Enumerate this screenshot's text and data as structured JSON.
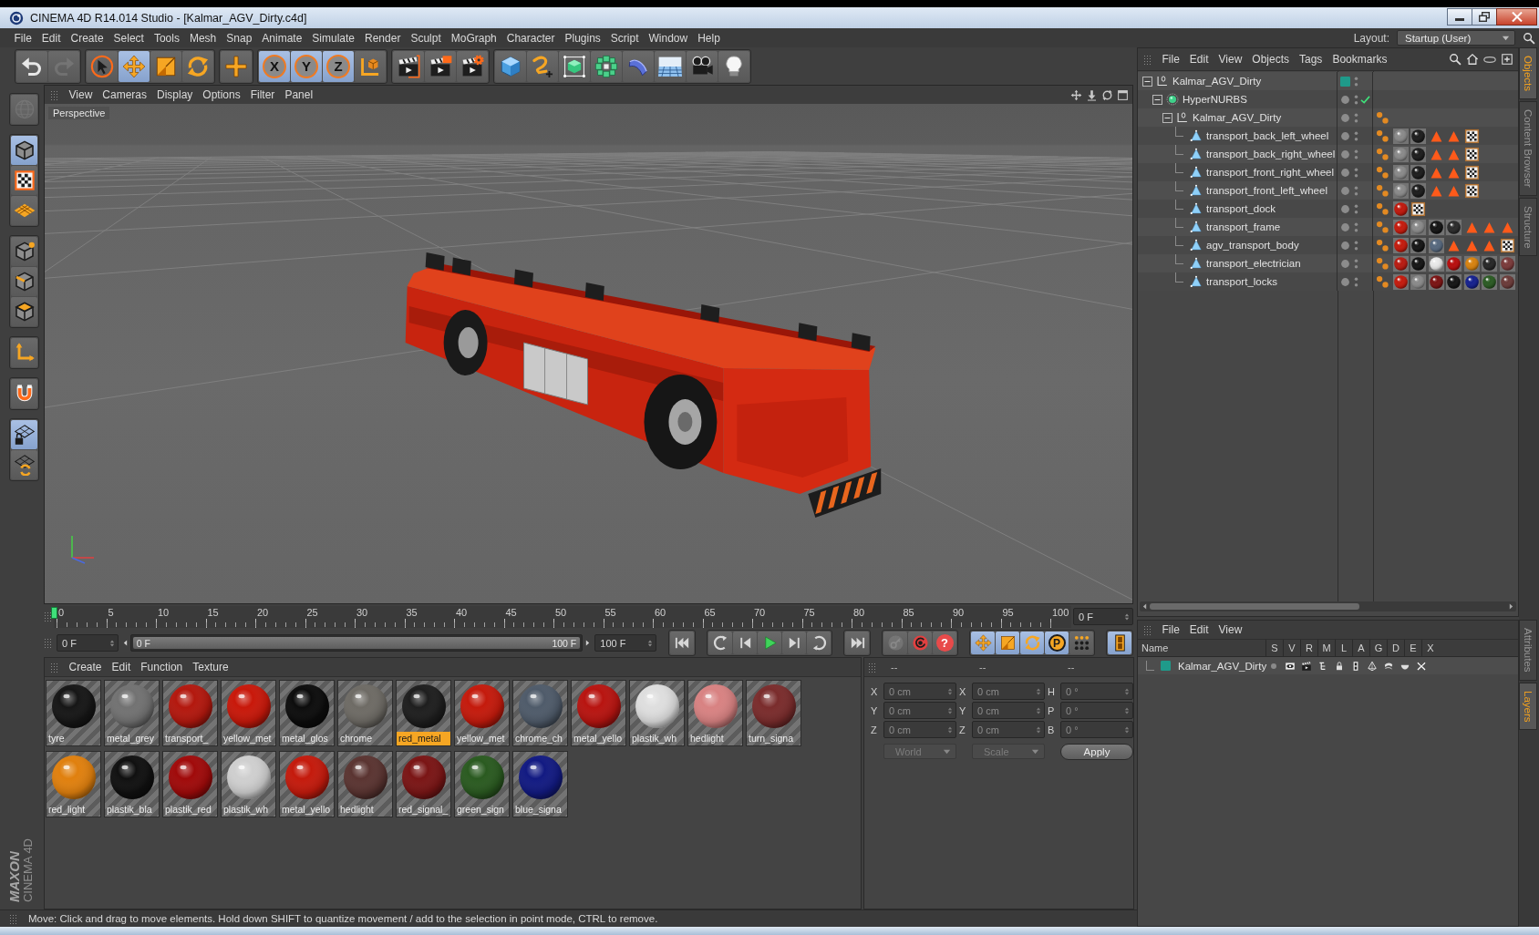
{
  "window": {
    "title": "CINEMA 4D R14.014 Studio - [Kalmar_AGV_Dirty.c4d]"
  },
  "menu_bar": {
    "items": [
      "File",
      "Edit",
      "Create",
      "Select",
      "Tools",
      "Mesh",
      "Snap",
      "Animate",
      "Simulate",
      "Render",
      "Sculpt",
      "MoGraph",
      "Character",
      "Plugins",
      "Script",
      "Window",
      "Help"
    ],
    "layout_label": "Layout:",
    "layout_value": "Startup (User)"
  },
  "toolbar": [
    [
      {
        "kind": "undo",
        "selected": false,
        "disabled": false
      },
      {
        "kind": "redo",
        "selected": false,
        "disabled": true
      }
    ],
    [
      {
        "kind": "select",
        "selected": false,
        "disabled": false
      },
      {
        "kind": "move",
        "selected": true,
        "disabled": false
      },
      {
        "kind": "scale",
        "selected": false,
        "disabled": false
      },
      {
        "kind": "rotate",
        "selected": false,
        "disabled": false
      }
    ],
    [
      {
        "kind": "recent",
        "selected": false,
        "disabled": false
      }
    ],
    [
      {
        "kind": "axislock",
        "label": "X",
        "selected": true,
        "disabled": false
      },
      {
        "kind": "axislock",
        "label": "Y",
        "selected": true,
        "disabled": false
      },
      {
        "kind": "axislock",
        "label": "Z",
        "selected": true,
        "disabled": false
      },
      {
        "kind": "coords",
        "selected": false,
        "disabled": false
      }
    ],
    [
      {
        "kind": "renderview",
        "selected": false,
        "disabled": false
      },
      {
        "kind": "renderpv",
        "selected": false,
        "disabled": false
      },
      {
        "kind": "rendersettings",
        "selected": false,
        "disabled": false
      }
    ],
    [
      {
        "kind": "cube",
        "selected": false,
        "disabled": false
      },
      {
        "kind": "spline",
        "selected": false,
        "disabled": false
      },
      {
        "kind": "subdiv",
        "selected": false,
        "disabled": false
      },
      {
        "kind": "array",
        "selected": false,
        "disabled": false
      },
      {
        "kind": "deformer",
        "selected": false,
        "disabled": false
      },
      {
        "kind": "floor",
        "selected": false,
        "disabled": false
      },
      {
        "kind": "camera",
        "selected": false,
        "disabled": false
      },
      {
        "kind": "light",
        "selected": false,
        "disabled": false
      }
    ]
  ],
  "mode_toolbar": [
    [
      {
        "kind": "editable",
        "selected": false,
        "disabled": true
      }
    ],
    [
      {
        "kind": "model",
        "selected": true,
        "disabled": false
      },
      {
        "kind": "texture",
        "selected": false,
        "disabled": false
      },
      {
        "kind": "workplane",
        "selected": false,
        "disabled": false
      }
    ],
    [
      {
        "kind": "points",
        "selected": false,
        "disabled": false
      },
      {
        "kind": "edges",
        "selected": false,
        "disabled": false
      },
      {
        "kind": "polygons",
        "selected": false,
        "disabled": false
      }
    ],
    [
      {
        "kind": "axismode",
        "selected": false,
        "disabled": false
      }
    ],
    [
      {
        "kind": "magnet",
        "selected": false,
        "disabled": false
      }
    ],
    [
      {
        "kind": "lockplane",
        "selected": true,
        "disabled": false
      },
      {
        "kind": "planecycle",
        "selected": false,
        "disabled": false
      }
    ]
  ],
  "viewport": {
    "menu": [
      "View",
      "Cameras",
      "Display",
      "Options",
      "Filter",
      "Panel"
    ],
    "camera": "Perspective"
  },
  "timeline": {
    "ticks": [
      "0",
      "5",
      "10",
      "15",
      "20",
      "25",
      "30",
      "35",
      "40",
      "45",
      "50",
      "55",
      "60",
      "65",
      "70",
      "75",
      "80",
      "85",
      "90",
      "95",
      "100"
    ],
    "playhead": {
      "level": 0
    },
    "current_frame": "0 F"
  },
  "playback": {
    "start_field": "0 F",
    "range": {
      "start": "0 F",
      "end": "100 F",
      "level": 1
    },
    "end_field": "100 F",
    "buttons": [
      [
        {
          "kind": "start",
          "selected": false,
          "disabled": false
        }
      ],
      [
        {
          "kind": "prevkey",
          "selected": false,
          "disabled": false
        },
        {
          "kind": "prevframe",
          "selected": false,
          "disabled": false
        },
        {
          "kind": "play",
          "selected": false,
          "disabled": false
        },
        {
          "kind": "nextframe",
          "selected": false,
          "disabled": false
        },
        {
          "kind": "nextkey",
          "selected": false,
          "disabled": false
        }
      ],
      [
        {
          "kind": "end",
          "selected": false,
          "disabled": false
        }
      ],
      [
        {
          "kind": "key",
          "selected": false,
          "disabled": true
        },
        {
          "kind": "autokey",
          "selected": false,
          "disabled": false
        },
        {
          "kind": "keysel",
          "label": "?",
          "selected": false,
          "disabled": false
        }
      ],
      [
        {
          "kind": "pos",
          "selected": true,
          "disabled": false
        },
        {
          "kind": "scl",
          "selected": true,
          "disabled": false
        },
        {
          "kind": "rot",
          "selected": true,
          "disabled": false
        },
        {
          "kind": "param",
          "label": "P",
          "selected": true,
          "disabled": false
        },
        {
          "kind": "pla",
          "selected": false,
          "disabled": false
        }
      ],
      [
        {
          "kind": "timeline",
          "selected": true,
          "disabled": false
        }
      ]
    ]
  },
  "material_manager": {
    "menu": [
      "Create",
      "Edit",
      "Function",
      "Texture"
    ],
    "materials": [
      {
        "name": "tyre",
        "color": "#161616",
        "selected": false
      },
      {
        "name": "metal_grey",
        "color": "#727272",
        "selected": false
      },
      {
        "name": "transport_",
        "color": "#b3180e",
        "selected": false
      },
      {
        "name": "yellow_met",
        "color": "#c8180a",
        "selected": false
      },
      {
        "name": "metal_glos",
        "color": "#0c0c0c",
        "selected": false
      },
      {
        "name": "chrome",
        "color": "#6e6b65",
        "selected": false
      },
      {
        "name": "red_metal",
        "color": "#1e1e1e",
        "selected": true
      },
      {
        "name": "yellow_met",
        "color": "#c41a0c",
        "selected": false
      },
      {
        "name": "chrome_ch",
        "color": "#4f5b6a",
        "selected": false
      },
      {
        "name": "metal_yello",
        "color": "#b81410",
        "selected": false
      },
      {
        "name": "plastik_wh",
        "color": "#dedede",
        "selected": false
      },
      {
        "name": "hedlight",
        "color": "#d88282",
        "selected": false
      },
      {
        "name": "turn_signa",
        "color": "#7a2c2c",
        "selected": false
      },
      {
        "name": "red_light",
        "color": "#e0800e",
        "selected": false
      },
      {
        "name": "plastik_bla",
        "color": "#101010",
        "selected": false
      },
      {
        "name": "plastik_red",
        "color": "#a00a0a",
        "selected": false
      },
      {
        "name": "plastik_wh",
        "color": "#cfcfcf",
        "selected": false
      },
      {
        "name": "metal_yello",
        "color": "#c41a0c",
        "selected": false
      },
      {
        "name": "hedlight",
        "color": "#5a3431",
        "selected": false
      },
      {
        "name": "red_signal_",
        "color": "#7a1515",
        "selected": false
      },
      {
        "name": "green_sign",
        "color": "#2a5a20",
        "selected": false
      },
      {
        "name": "blue_signa",
        "color": "#121a82",
        "selected": false
      }
    ]
  },
  "coordinates": {
    "headers": [
      "--",
      "--",
      "--"
    ],
    "rows": [
      [
        {
          "axis": "X",
          "value": "0 cm"
        },
        {
          "axis": "X",
          "value": "0 cm"
        },
        {
          "axis": "H",
          "value": "0 °"
        }
      ],
      [
        {
          "axis": "Y",
          "value": "0 cm"
        },
        {
          "axis": "Y",
          "value": "0 cm"
        },
        {
          "axis": "P",
          "value": "0 °"
        }
      ],
      [
        {
          "axis": "Z",
          "value": "0 cm"
        },
        {
          "axis": "Z",
          "value": "0 cm"
        },
        {
          "axis": "B",
          "value": "0 °"
        }
      ]
    ],
    "dropdowns": [
      {
        "value": "World",
        "disabled": true
      },
      {
        "value": "Scale",
        "disabled": true
      }
    ],
    "apply": "Apply"
  },
  "object_manager": {
    "menu": [
      "File",
      "Edit",
      "View",
      "Objects",
      "Tags",
      "Bookmarks"
    ],
    "objects": [
      {
        "name": "Kalmar_AGV_Dirty",
        "kind": "null",
        "color": "#1f9a8a",
        "expanded": true,
        "selected": false,
        "children": [
          {
            "name": "HyperNURBS",
            "kind": "subdiv",
            "enabled": true,
            "expanded": true,
            "selected": false,
            "children": [
              {
                "name": "Kalmar_AGV_Dirty",
                "kind": "null",
                "expanded": true,
                "selected": false,
                "tags": [
                  {
                    "kind": "phong"
                  }
                ],
                "children": [
                  {
                    "name": "transport_back_left_wheel",
                    "kind": "polygon",
                    "selected": false,
                    "tags": [
                      {
                        "kind": "phong"
                      },
                      {
                        "kind": "material",
                        "color": "#8a8a8a"
                      },
                      {
                        "kind": "material",
                        "color": "#1c1c1c"
                      },
                      {
                        "kind": "selection"
                      },
                      {
                        "kind": "selection"
                      },
                      {
                        "kind": "uvw"
                      }
                    ]
                  },
                  {
                    "name": "transport_back_right_wheel",
                    "kind": "polygon",
                    "selected": false,
                    "tags": [
                      {
                        "kind": "phong"
                      },
                      {
                        "kind": "material",
                        "color": "#8a8a8a"
                      },
                      {
                        "kind": "material",
                        "color": "#1c1c1c"
                      },
                      {
                        "kind": "selection"
                      },
                      {
                        "kind": "selection"
                      },
                      {
                        "kind": "uvw"
                      }
                    ]
                  },
                  {
                    "name": "transport_front_right_wheel",
                    "kind": "polygon",
                    "selected": false,
                    "tags": [
                      {
                        "kind": "phong"
                      },
                      {
                        "kind": "material",
                        "color": "#8a8a8a"
                      },
                      {
                        "kind": "material",
                        "color": "#1c1c1c"
                      },
                      {
                        "kind": "selection"
                      },
                      {
                        "kind": "selection"
                      },
                      {
                        "kind": "uvw"
                      }
                    ]
                  },
                  {
                    "name": "transport_front_left_wheel",
                    "kind": "polygon",
                    "selected": false,
                    "tags": [
                      {
                        "kind": "phong"
                      },
                      {
                        "kind": "material",
                        "color": "#8a8a8a"
                      },
                      {
                        "kind": "material",
                        "color": "#1c1c1c"
                      },
                      {
                        "kind": "selection"
                      },
                      {
                        "kind": "selection"
                      },
                      {
                        "kind": "uvw"
                      }
                    ]
                  },
                  {
                    "name": "transport_dock",
                    "kind": "polygon",
                    "selected": false,
                    "tags": [
                      {
                        "kind": "phong"
                      },
                      {
                        "kind": "material",
                        "color": "#c0180c"
                      },
                      {
                        "kind": "uvw"
                      }
                    ]
                  },
                  {
                    "name": "transport_frame",
                    "kind": "polygon",
                    "selected": false,
                    "tags": [
                      {
                        "kind": "phong"
                      },
                      {
                        "kind": "material",
                        "color": "#c41a0c"
                      },
                      {
                        "kind": "material",
                        "color": "#8a8a8a"
                      },
                      {
                        "kind": "material",
                        "color": "#141414"
                      },
                      {
                        "kind": "material",
                        "color": "#2a2a2a"
                      },
                      {
                        "kind": "selection"
                      },
                      {
                        "kind": "selection"
                      },
                      {
                        "kind": "selection"
                      }
                    ]
                  },
                  {
                    "name": "agv_transport_body",
                    "kind": "polygon",
                    "selected": false,
                    "tags": [
                      {
                        "kind": "phong"
                      },
                      {
                        "kind": "material",
                        "color": "#c41a0c"
                      },
                      {
                        "kind": "material",
                        "color": "#141414"
                      },
                      {
                        "kind": "material",
                        "color": "#56687e"
                      },
                      {
                        "kind": "selection"
                      },
                      {
                        "kind": "selection"
                      },
                      {
                        "kind": "selection"
                      },
                      {
                        "kind": "uvw"
                      }
                    ]
                  },
                  {
                    "name": "transport_electrician",
                    "kind": "polygon",
                    "selected": false,
                    "tags": [
                      {
                        "kind": "phong"
                      },
                      {
                        "kind": "material",
                        "color": "#b81a10"
                      },
                      {
                        "kind": "material",
                        "color": "#141414"
                      },
                      {
                        "kind": "material",
                        "color": "#e8e8e8"
                      },
                      {
                        "kind": "material",
                        "color": "#b80c0c"
                      },
                      {
                        "kind": "material",
                        "color": "#d8820e"
                      },
                      {
                        "kind": "material",
                        "color": "#262626"
                      },
                      {
                        "kind": "material",
                        "color": "#7a3a3a"
                      }
                    ]
                  },
                  {
                    "name": "transport_locks",
                    "kind": "polygon",
                    "selected": false,
                    "tags": [
                      {
                        "kind": "phong"
                      },
                      {
                        "kind": "material",
                        "color": "#c41a0c"
                      },
                      {
                        "kind": "material",
                        "color": "#8a8a8a"
                      },
                      {
                        "kind": "material",
                        "color": "#7a1212"
                      },
                      {
                        "kind": "material",
                        "color": "#141414"
                      },
                      {
                        "kind": "material",
                        "color": "#14208e"
                      },
                      {
                        "kind": "material",
                        "color": "#2a5a22"
                      },
                      {
                        "kind": "material",
                        "color": "#6a3a38"
                      }
                    ]
                  }
                ]
              }
            ]
          }
        ]
      }
    ]
  },
  "layer_manager": {
    "menu": [
      "File",
      "Edit",
      "View"
    ],
    "columns": [
      "Name",
      "S",
      "V",
      "R",
      "M",
      "L",
      "A",
      "G",
      "D",
      "E",
      "X"
    ],
    "layers": [
      {
        "name": "Kalmar_AGV_Dirty",
        "color": "#1f9a8a",
        "selected": false
      }
    ]
  },
  "side_tabs": {
    "upper": [
      {
        "label": "Objects",
        "selected": true
      },
      {
        "label": "Content Browser",
        "selected": false
      },
      {
        "label": "Structure",
        "selected": false
      }
    ],
    "lower": [
      {
        "label": "Attributes",
        "selected": false
      },
      {
        "label": "Layers",
        "selected": true
      }
    ]
  },
  "logo": {
    "brand": "MAXON",
    "product": "CINEMA 4D"
  },
  "status_bar": {
    "message": "Move: Click and drag to move elements. Hold down SHIFT to quantize movement / add to the selection in point mode, CTRL to remove."
  }
}
